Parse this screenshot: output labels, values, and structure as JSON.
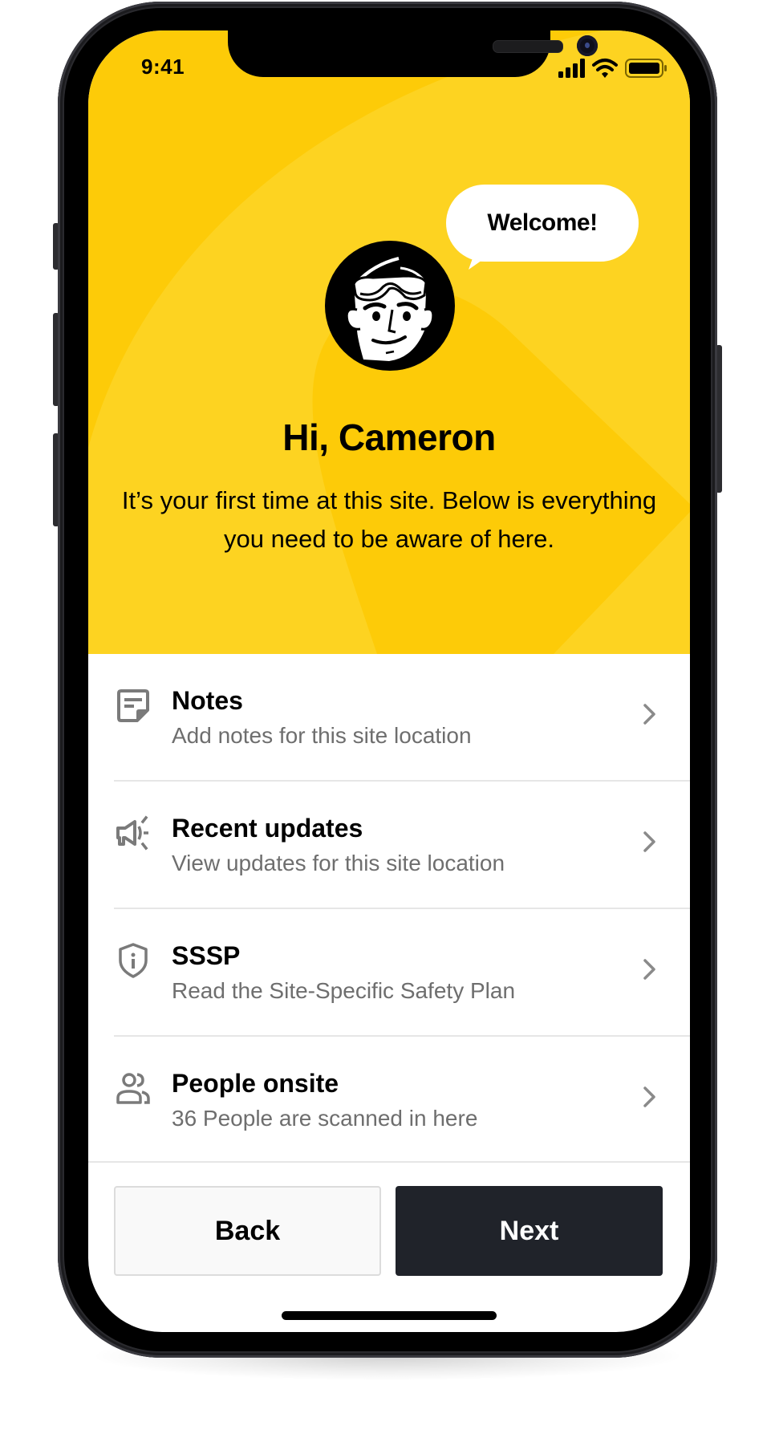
{
  "status_bar": {
    "time": "9:41",
    "icons": [
      "signal-icon",
      "wifi-icon",
      "battery-icon"
    ]
  },
  "hero": {
    "bubble_text": "Welcome!",
    "avatar": "worker-avatar-with-goggles",
    "title": "Hi, Cameron",
    "subtitle": "It’s your first time at this site. Below is everything you need to be aware of here."
  },
  "items": [
    {
      "icon": "notes-icon",
      "title": "Notes",
      "subtitle": "Add notes for this site location"
    },
    {
      "icon": "megaphone-icon",
      "title": "Recent updates",
      "subtitle": "View updates for this site location"
    },
    {
      "icon": "shield-info-icon",
      "title": "SSSP",
      "subtitle": "Read the Site-Specific Safety Plan"
    },
    {
      "icon": "people-icon",
      "title": "People onsite",
      "subtitle": "36 People are scanned in here"
    }
  ],
  "footer": {
    "back_label": "Back",
    "next_label": "Next"
  },
  "colors": {
    "hero_yellow": "#FDCB08",
    "hero_yellow_light": "#FDD321",
    "primary_button": "#20232A",
    "secondary_text": "#6E6E6E",
    "icon_gray": "#7A7A7A"
  }
}
